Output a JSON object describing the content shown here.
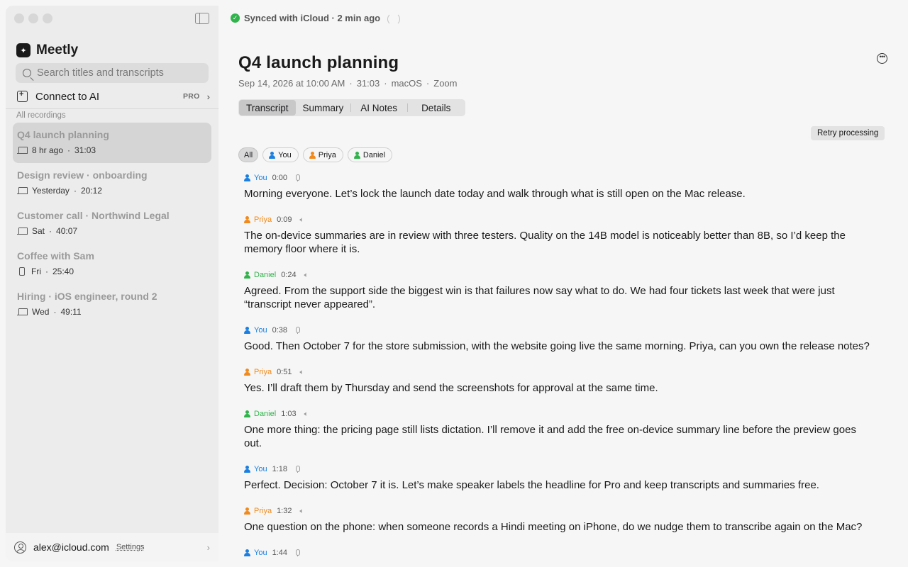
{
  "sync": {
    "text": "Synced with iCloud · 2 min ago"
  },
  "app": {
    "name": "Meetly"
  },
  "search": {
    "placeholder": "Search titles and transcripts"
  },
  "connect": {
    "label": "Connect to AI",
    "badge": "PRO"
  },
  "sidebar": {
    "section_label": "All recordings",
    "recordings": [
      {
        "title": "Q4 launch planning",
        "when": "8 hr ago",
        "duration": "31:03",
        "device": "laptop-icon",
        "active": true
      },
      {
        "title": "Design review · onboarding",
        "when": "Yesterday",
        "duration": "20:12",
        "device": "laptop-icon"
      },
      {
        "title": "Customer call · Northwind Legal",
        "when": "Sat",
        "duration": "40:07",
        "device": "laptop-icon"
      },
      {
        "title": "Coffee with Sam",
        "when": "Fri",
        "duration": "25:40",
        "device": "phone-icon"
      },
      {
        "title": "Hiring · iOS engineer, round 2",
        "when": "Wed",
        "duration": "49:11",
        "device": "laptop-icon"
      }
    ]
  },
  "account": {
    "email": "alex@icloud.com",
    "settings_label": "Settings"
  },
  "meeting": {
    "title": "Q4 launch planning",
    "date": "Sep 14, 2026 at 10:00 AM",
    "duration": "31:03",
    "platform": "macOS",
    "app": "Zoom",
    "separator": "·"
  },
  "tabs": [
    "Transcript",
    "Summary",
    "AI Notes",
    "Details"
  ],
  "retry_label": "Retry processing",
  "filters": [
    "All",
    "You",
    "Priya",
    "Daniel"
  ],
  "colors": {
    "you": "#1a7fe0",
    "priya": "#f08a1c",
    "daniel": "#2fb34a"
  },
  "transcript": [
    {
      "speaker": "You",
      "time": "0:00",
      "source": "mic",
      "text": "Morning everyone. Let’s lock the launch date today and walk through what is still open on the Mac release."
    },
    {
      "speaker": "Priya",
      "time": "0:09",
      "source": "speaker",
      "text": "The on-device summaries are in review with three testers. Quality on the 14B model is noticeably better than 8B, so I’d keep the memory floor where it is."
    },
    {
      "speaker": "Daniel",
      "time": "0:24",
      "source": "speaker",
      "text": "Agreed. From the support side the biggest win is that failures now say what to do. We had four tickets last week that were just “transcript never appeared”."
    },
    {
      "speaker": "You",
      "time": "0:38",
      "source": "mic",
      "text": "Good. Then October 7 for the store submission, with the website going live the same morning. Priya, can you own the release notes?"
    },
    {
      "speaker": "Priya",
      "time": "0:51",
      "source": "speaker",
      "text": "Yes. I’ll draft them by Thursday and send the screenshots for approval at the same time."
    },
    {
      "speaker": "Daniel",
      "time": "1:03",
      "source": "speaker",
      "text": "One more thing: the pricing page still lists dictation. I’ll remove it and add the free on-device summary line before the preview goes out."
    },
    {
      "speaker": "You",
      "time": "1:18",
      "source": "mic",
      "text": "Perfect. Decision: October 7 it is. Let’s make speaker labels the headline for Pro and keep transcripts and summaries free."
    },
    {
      "speaker": "Priya",
      "time": "1:32",
      "source": "speaker",
      "text": "One question on the phone: when someone records a Hindi meeting on iPhone, do we nudge them to transcribe again on the Mac?"
    },
    {
      "speaker": "You",
      "time": "1:44",
      "source": "mic",
      "text": ""
    }
  ]
}
